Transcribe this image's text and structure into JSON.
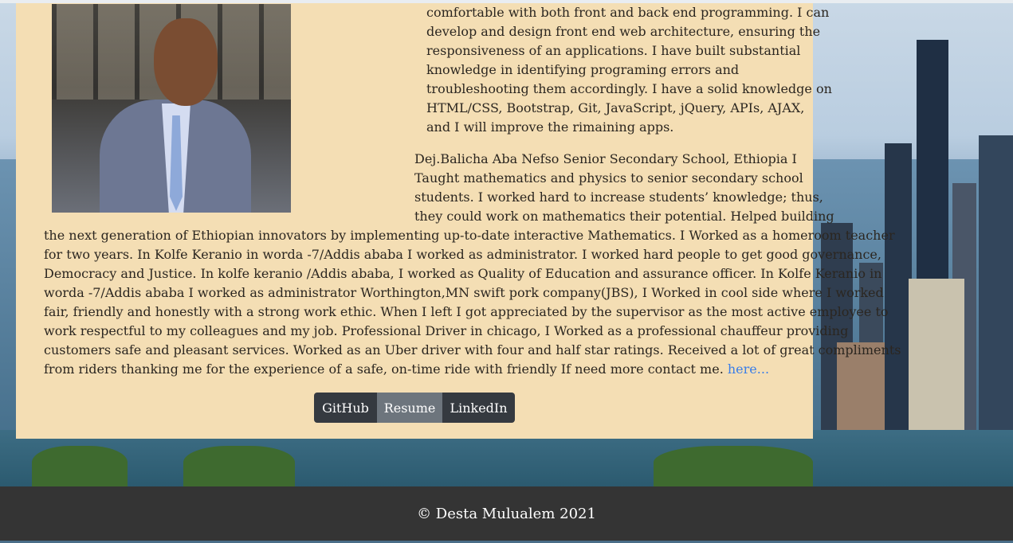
{
  "profile": {
    "photo_alt": "Desta Mulualem portrait"
  },
  "about": {
    "para1_lines": [
      "comfortable with both front and back end programming. I can",
      "develop and design front end web architecture, ensuring the",
      "responsiveness of an applications. I have built substantial",
      "knowledge in identifying programing errors and",
      "troubleshooting them accordingly. I have a solid knowledge on",
      "HTML/CSS, Bootstrap, Git, JavaScript, jQuery, APIs, AJAX,",
      "and I will improve the rimaining apps."
    ],
    "para2_top_lines": [
      "Dej.Balicha Aba Nefso Senior Secondary School, Ethiopia I",
      "Taught mathematics and physics to senior secondary school",
      "students. I worked hard to increase students’ knowledge; thus,",
      "they could work on mathematics their potential. Helped building"
    ],
    "para2_bottom_lines": [
      "the next generation of Ethiopian innovators by implementing up-to-date interactive Mathematics. I Worked as a homeroom teacher",
      "for two years. In Kolfe Keranio in worda -7/Addis ababa I worked as administrator. I worked hard people to get good governance,",
      "Democracy and Justice. In kolfe keranio /Addis ababa, I worked as Quality of Education and assurance officer. In Kolfe Keranio in",
      "worda -7/Addis ababa I worked as administrator Worthington,MN swift pork company(JBS), I Worked in cool side where I worked",
      "fair, friendly and honestly with a strong work ethic. When I left I got appreciated by the supervisor as the most active employee to",
      "work respectful to my colleagues and my job. Professional Driver in chicago, I Worked as a professional chauffeur providing",
      "customers safe and pleasant services. Worked as an Uber driver with four and half star ratings. Received a lot of great compliments"
    ],
    "last_line_text": "from riders thanking me for the experience of a safe, on-time ride with friendly If need more contact me. ",
    "contact_link_label": "here..."
  },
  "buttons": {
    "github": "GitHub",
    "resume": "Resume",
    "linkedin": "LinkedIn"
  },
  "footer": {
    "copyright": "© Desta Mulualem 2021"
  },
  "colors": {
    "card_background": "#f4deb4",
    "link": "#3a7ee8",
    "button_dark": "#353a40",
    "button_grey": "#6d757d",
    "footer_background": "#343434"
  }
}
